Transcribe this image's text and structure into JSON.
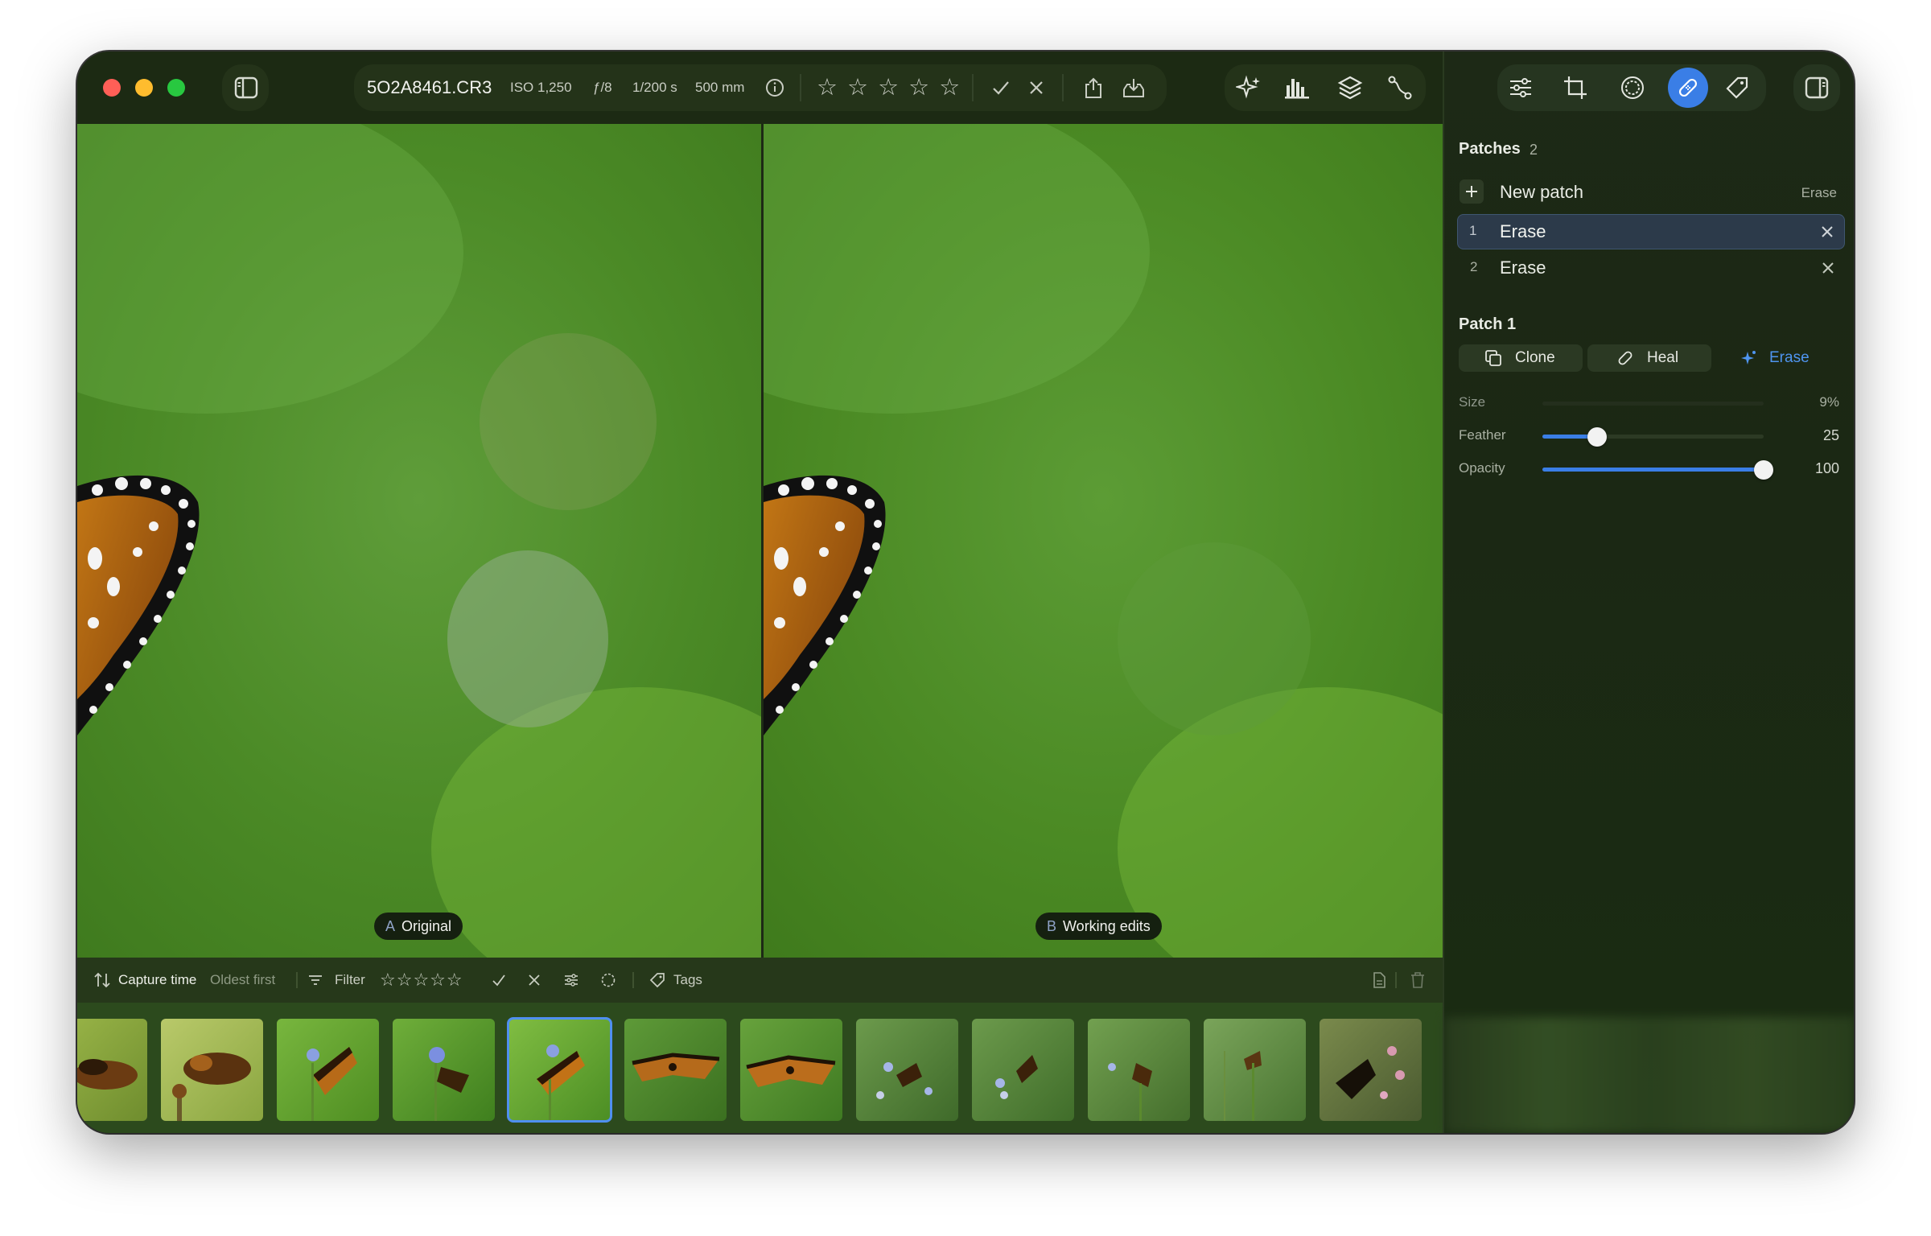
{
  "file": {
    "name": "5O2A8461.CR3",
    "iso": "ISO 1,250",
    "aperture": "ƒ/8",
    "shutter": "1/200 s",
    "focal": "500 mm"
  },
  "viewer": {
    "left_letter": "A",
    "left_label": "Original",
    "right_letter": "B",
    "right_label": "Working edits"
  },
  "filmstrip": {
    "sort_label": "Capture time",
    "sort_order": "Oldest first",
    "filter_label": "Filter",
    "stars": "☆☆☆☆☆",
    "tags_label": "Tags",
    "selected_index": 4,
    "thumbnail_count": 12
  },
  "toolbar_stars": "☆ ☆ ☆ ☆ ☆",
  "panel": {
    "patches_title": "Patches",
    "patches_count": "2",
    "new_patch_label": "New patch",
    "new_patch_mode": "Erase",
    "patches": [
      {
        "index": "1",
        "label": "Erase"
      },
      {
        "index": "2",
        "label": "Erase"
      }
    ],
    "patch_heading": "Patch 1",
    "modes": {
      "clone": "Clone",
      "heal": "Heal",
      "erase": "Erase"
    },
    "sliders": {
      "size_label": "Size",
      "size_value": "9%",
      "feather_label": "Feather",
      "feather_value": "25",
      "opacity_label": "Opacity",
      "opacity_value": "100"
    }
  },
  "colors": {
    "accent": "#3a7ee6",
    "erase_text": "#4f95f0",
    "selected_row": "#2c3a4a"
  }
}
